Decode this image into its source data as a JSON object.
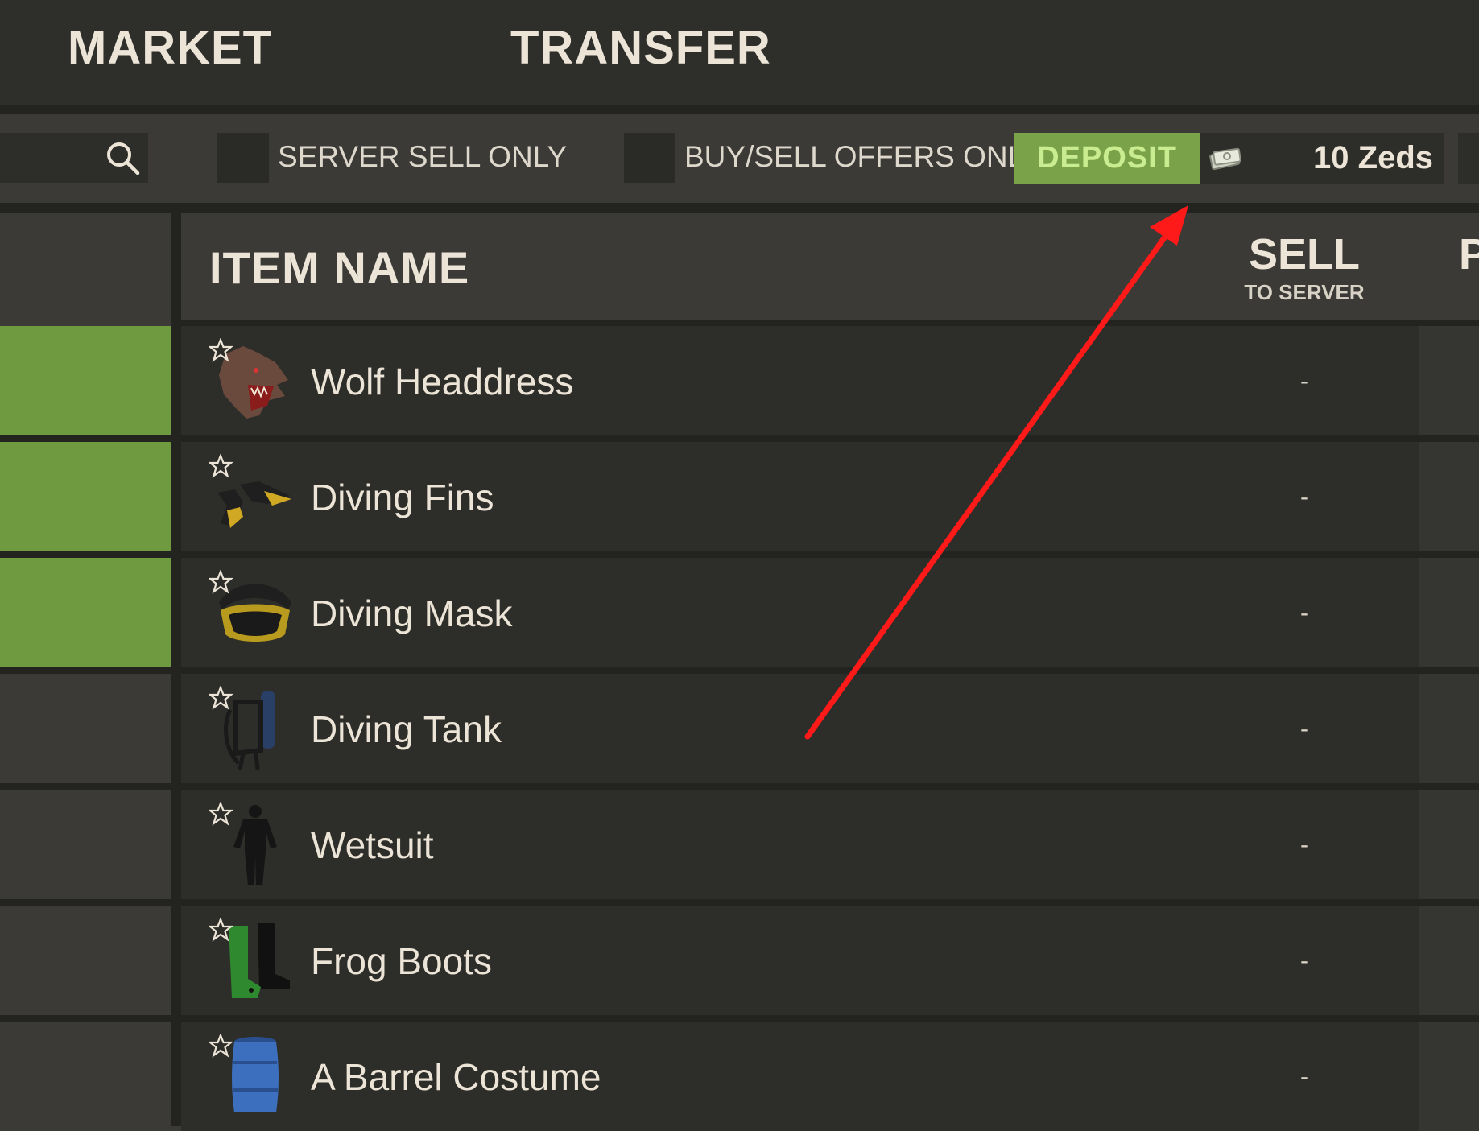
{
  "tabs": {
    "market": "MARKET",
    "transfer": "TRANSFER"
  },
  "filters": {
    "server_sell_only": "SERVER SELL ONLY",
    "buy_sell_offers_only": "BUY/SELL OFFERS ONLY"
  },
  "wallet": {
    "deposit_label": "DEPOSIT",
    "balance": "10 Zeds"
  },
  "table": {
    "columns": {
      "item_name": "ITEM NAME",
      "sell": "SELL",
      "sell_sub": "TO SERVER",
      "next_col_partial": "P"
    },
    "rows": [
      {
        "name": "Wolf Headdress",
        "sell": "-",
        "icon": "wolf-headdress-icon"
      },
      {
        "name": "Diving Fins",
        "sell": "-",
        "icon": "diving-fins-icon"
      },
      {
        "name": "Diving Mask",
        "sell": "-",
        "icon": "diving-mask-icon"
      },
      {
        "name": "Diving Tank",
        "sell": "-",
        "icon": "diving-tank-icon"
      },
      {
        "name": "Wetsuit",
        "sell": "-",
        "icon": "wetsuit-icon"
      },
      {
        "name": "Frog Boots",
        "sell": "-",
        "icon": "frog-boots-icon"
      },
      {
        "name": "A Barrel Costume",
        "sell": "-",
        "icon": "barrel-costume-icon"
      }
    ]
  },
  "colors": {
    "accent_green": "#7aa349",
    "deposit_text": "#c9ec90",
    "annotation_arrow": "#ff1a1a"
  }
}
